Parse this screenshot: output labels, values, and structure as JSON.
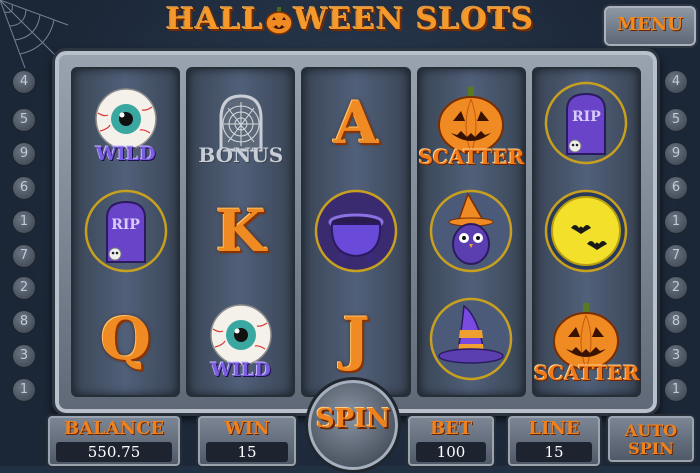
{
  "title": "HALLOWEEN SLOTS",
  "title_parts": {
    "pre": "HALL",
    "post": "WEEN SLOTS"
  },
  "menu_label": "MENU",
  "left_numbers": [
    "4",
    "5",
    "9",
    "6",
    "1",
    "7",
    "2",
    "8",
    "3",
    "1"
  ],
  "right_numbers": [
    "4",
    "5",
    "9",
    "6",
    "1",
    "7",
    "2",
    "8",
    "3",
    "1"
  ],
  "reels": [
    [
      "eyeball-wild",
      "tombstone-rip",
      "letter-Q"
    ],
    [
      "cobweb-bonus",
      "letter-K",
      "eyeball-wild"
    ],
    [
      "letter-A",
      "cauldron",
      "letter-J"
    ],
    [
      "pumpkin-scatter",
      "witch-owl",
      "witch-hat"
    ],
    [
      "tombstone-rip",
      "moon-bats",
      "pumpkin-scatter"
    ]
  ],
  "symbol_text": {
    "wild": "WILD",
    "bonus": "BONUS",
    "scatter": "SCATTER",
    "rip": "RIP",
    "letter_A": "A",
    "letter_K": "K",
    "letter_Q": "Q",
    "letter_J": "J"
  },
  "bottom": {
    "balance_label": "BALANCE",
    "balance_value": "550.75",
    "win_label": "WIN",
    "win_value": "15",
    "spin_label": "SPIN",
    "bet_label": "BET",
    "bet_value": "100",
    "line_label": "LINE",
    "line_value": "15",
    "auto_label_1": "AUTO",
    "auto_label_2": "SPIN"
  },
  "colors": {
    "accent_orange": "#f08a23",
    "purple": "#5b3fb0",
    "frame_gray": "#7d8796",
    "background": "#223044"
  }
}
